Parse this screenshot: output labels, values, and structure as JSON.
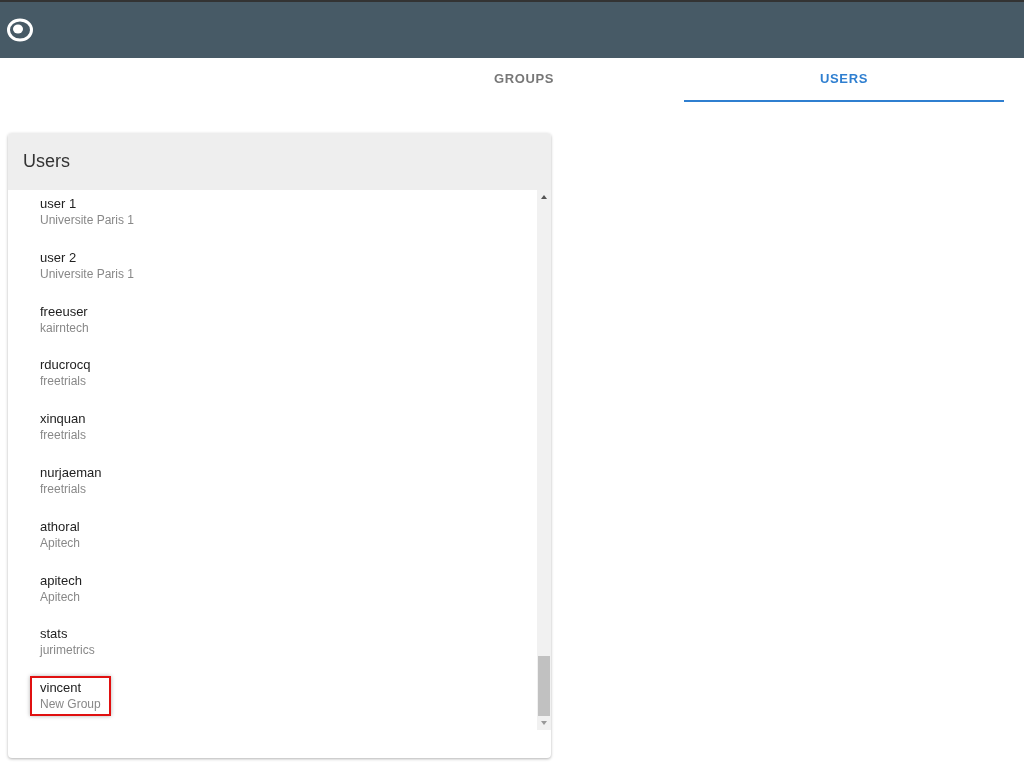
{
  "tabs": [
    {
      "label": "GROUPS",
      "selected": false
    },
    {
      "label": "USERS",
      "selected": true
    }
  ],
  "panel": {
    "title": "Users",
    "users": [
      {
        "name": "user 1",
        "group": "Universite Paris 1",
        "highlighted": false
      },
      {
        "name": "user 2",
        "group": "Universite Paris 1",
        "highlighted": false
      },
      {
        "name": "freeuser",
        "group": "kairntech",
        "highlighted": false
      },
      {
        "name": "rducrocq",
        "group": "freetrials",
        "highlighted": false
      },
      {
        "name": "xinquan",
        "group": "freetrials",
        "highlighted": false
      },
      {
        "name": "nurjaeman",
        "group": "freetrials",
        "highlighted": false
      },
      {
        "name": "athoral",
        "group": "Apitech",
        "highlighted": false
      },
      {
        "name": "apitech",
        "group": "Apitech",
        "highlighted": false
      },
      {
        "name": "stats",
        "group": "jurimetrics",
        "highlighted": false
      },
      {
        "name": "vincent",
        "group": "New Group",
        "highlighted": true
      }
    ]
  }
}
